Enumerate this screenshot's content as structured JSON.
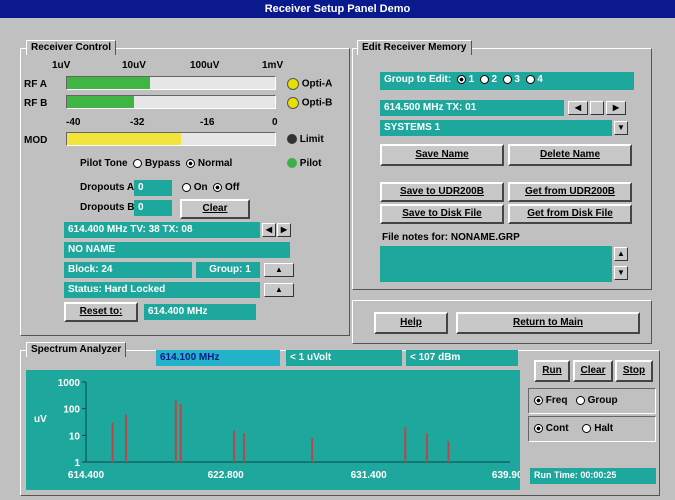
{
  "window": {
    "title": "Receiver Setup Panel Demo"
  },
  "receiver_control": {
    "tab_label": "Receiver Control",
    "scale_top": [
      "1uV",
      "10uV",
      "100uV",
      "1mV"
    ],
    "rf_a_label": "RF A",
    "rf_b_label": "RF B",
    "rf_a_level": 0.4,
    "rf_b_level": 0.32,
    "opti_a_label": "Opti-A",
    "opti_b_label": "Opti-B",
    "scale_mod": [
      "-40",
      "-32",
      "-16",
      "0"
    ],
    "mod_label": "MOD",
    "mod_level": 0.55,
    "limit_label": "Limit",
    "pilot_tone_label": "Pilot Tone",
    "bypass_label": "Bypass",
    "normal_label": "Normal",
    "pilot_label": "Pilot",
    "dropouts_a_label": "Dropouts A",
    "dropouts_a_value": "0",
    "dropouts_b_label": "Dropouts B",
    "dropouts_b_value": "0",
    "on_label": "On",
    "off_label": "Off",
    "clear_label": "Clear",
    "freq_field": "614.400 MHz  TV: 38  TX: 08",
    "name_field": "NO NAME",
    "block_field": "Block: 24",
    "group_field": "Group: 1",
    "status_field": "Status: Hard Locked",
    "reset_label": "Reset to:",
    "reset_value": "614.400 MHz"
  },
  "edit_memory": {
    "tab_label": "Edit Receiver Memory",
    "group_label": "Group to Edit:",
    "group_options": [
      "1",
      "2",
      "3",
      "4"
    ],
    "freq_field": "614.500 MHz   TX: 01",
    "systems_field": "SYSTEMS 1",
    "save_name": "Save Name",
    "delete_name": "Delete Name",
    "save_udr": "Save to UDR200B",
    "get_udr": "Get from UDR200B",
    "save_disk": "Save to Disk File",
    "get_disk": "Get from Disk File",
    "file_notes": "File notes for: NONAME.GRP",
    "notes_value": ""
  },
  "help_label": "Help",
  "return_label": "Return to Main",
  "spectrum": {
    "tab_label": "Spectrum Analyzer",
    "readout_freq": "614.100 MHz",
    "readout_level": "< 1 uVolt",
    "readout_db": "< 107 dBm",
    "ylabel": "uV",
    "run_label": "Run",
    "clear_label": "Clear",
    "stop_label": "Stop",
    "freq_label": "Freq",
    "group_label": "Group",
    "cont_label": "Cont",
    "halt_label": "Halt",
    "run_time_label": "Run Time: 00:00:25"
  },
  "chart_data": {
    "type": "bar",
    "ylabel": "uV",
    "yscale": "log",
    "ylim": [
      1,
      1000
    ],
    "ytick_labels": [
      "1000",
      "100",
      "10",
      "1"
    ],
    "xtick_labels": [
      "614.400",
      "622.800",
      "631.400",
      "639.900"
    ],
    "xlim": [
      614.4,
      639.9
    ],
    "x": [
      616.0,
      616.8,
      619.8,
      620.1,
      623.3,
      623.9,
      628.0,
      633.6,
      634.9,
      636.2
    ],
    "values": [
      30,
      60,
      200,
      150,
      15,
      12,
      8,
      20,
      12,
      6
    ]
  }
}
